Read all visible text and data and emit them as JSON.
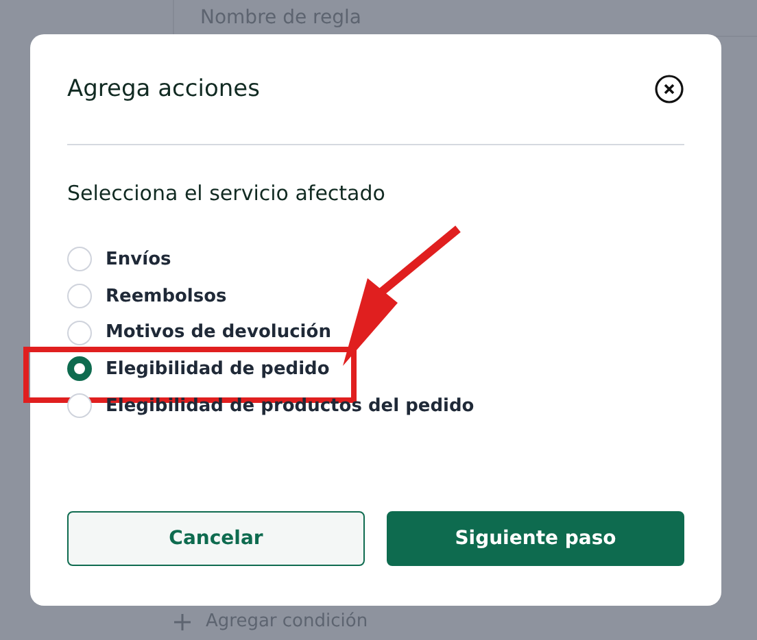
{
  "background": {
    "column_header": "Nombre de regla",
    "add_condition": "Agregar condición"
  },
  "dialog": {
    "title": "Agrega acciones",
    "heading": "Selecciona el servicio afectado",
    "options": [
      {
        "label": "Envíos",
        "selected": false,
        "highlighted": false
      },
      {
        "label": "Reembolsos",
        "selected": false,
        "highlighted": false
      },
      {
        "label": "Motivos de devolución",
        "selected": false,
        "highlighted": false
      },
      {
        "label": "Elegibilidad de pedido",
        "selected": true,
        "highlighted": true
      },
      {
        "label": "Elegibilidad de productos del pedido",
        "selected": false,
        "highlighted": false
      }
    ],
    "buttons": [
      {
        "label": "Cancelar",
        "kind": "secondary"
      },
      {
        "label": "Siguiente paso",
        "kind": "primary"
      }
    ]
  }
}
